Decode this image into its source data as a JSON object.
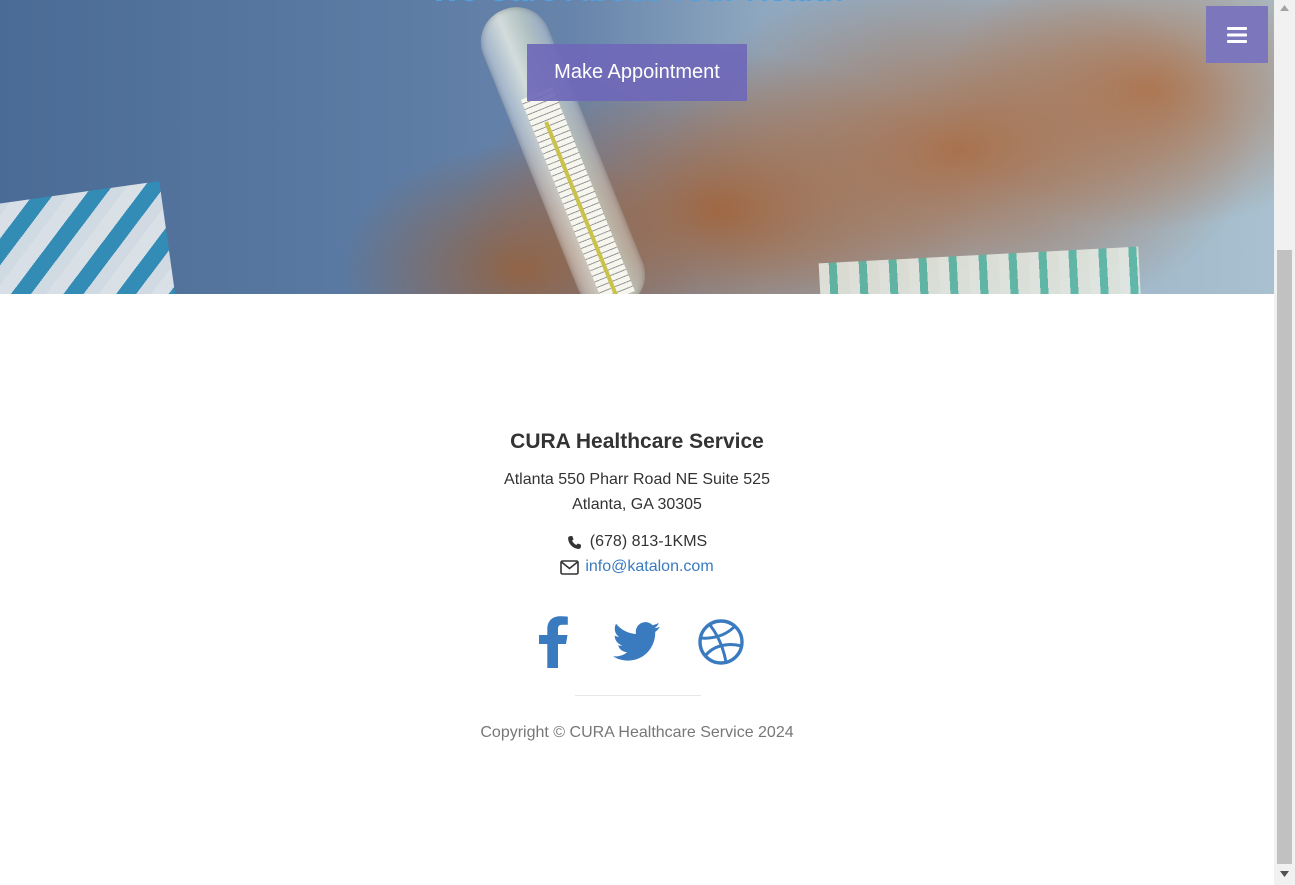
{
  "hero": {
    "heading": "We Care About Your Health",
    "appointment_button": "Make Appointment",
    "menu_icon": "bars-icon"
  },
  "footer": {
    "brand": "CURA Healthcare Service",
    "address_line1": "Atlanta 550 Pharr Road NE Suite 525",
    "address_line2": "Atlanta, GA 30305",
    "phone": "(678) 813-1KMS",
    "email": "info@katalon.com",
    "social": [
      {
        "icon": "facebook-icon"
      },
      {
        "icon": "twitter-icon"
      },
      {
        "icon": "dribbble-icon"
      }
    ],
    "copyright": "Copyright © CURA Healthcare Service 2024"
  },
  "colors": {
    "accent_button": "#6f68b8",
    "link": "#3a7bc0",
    "heading_blue": "#52a0dd"
  }
}
